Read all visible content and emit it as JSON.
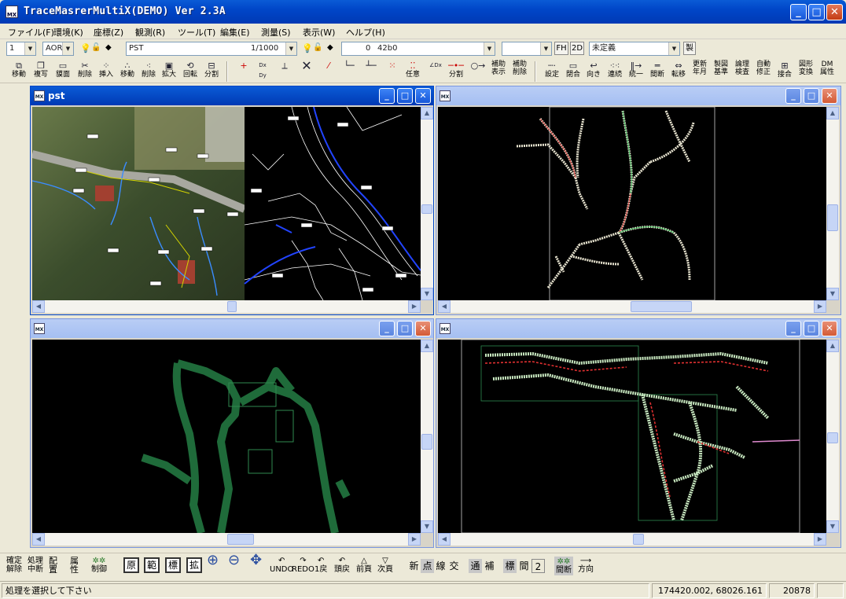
{
  "app": {
    "title": "TraceMasrerMultiX(DEMO) Ver 2.3A"
  },
  "menu": [
    "ファイル(F)",
    "環境(K)",
    "座標(Z)",
    "観測(R)",
    "ツール(T)",
    "編集(E)",
    "測量(S)",
    "表示(W)",
    "ヘルプ(H)"
  ],
  "row2": {
    "layer_num": "1",
    "mode": "AOR",
    "layer_name": "PST",
    "scale": "1/1000",
    "color_value": "0",
    "color_code": "42b0",
    "fh": "FH",
    "twod": "2D",
    "undefined_label": "未定義",
    "sei": "製"
  },
  "toolbar": {
    "group1": [
      "移動",
      "複写",
      "貘面",
      "削除",
      "挿入",
      "移動",
      "削除",
      "拡大",
      "回転",
      "分割"
    ],
    "group2": [
      "任意",
      "分割"
    ],
    "group2_aux": [
      [
        "補助",
        "表示"
      ],
      [
        "補助",
        "削除"
      ]
    ],
    "group3": [
      [
        "設定",
        ""
      ],
      [
        "閉合",
        ""
      ],
      [
        "向き",
        ""
      ],
      [
        "連続",
        ""
      ],
      [
        "統一",
        ""
      ],
      [
        "間断",
        ""
      ],
      [
        "転移",
        ""
      ],
      [
        "更新",
        "年月"
      ],
      [
        "製図",
        "基準"
      ],
      [
        "論理",
        "検査"
      ],
      [
        "自動",
        "修正"
      ],
      [
        "接合",
        ""
      ],
      [
        "図形",
        "変換"
      ],
      [
        "DM",
        "属性"
      ]
    ]
  },
  "windows": [
    {
      "title": "pst"
    },
    {
      "title": ""
    },
    {
      "title": ""
    },
    {
      "title": ""
    }
  ],
  "bottombar": {
    "g1": [
      [
        "確定",
        "解除"
      ],
      [
        "処理",
        "中断"
      ],
      [
        "配",
        "置"
      ],
      [
        "属",
        "性"
      ],
      [
        "",
        "制御"
      ]
    ],
    "boxes": [
      "原",
      "範",
      "標",
      "拡"
    ],
    "nav": [
      "UNDO",
      "REDO",
      "1戻",
      "頭戻",
      "前頁",
      "次頁"
    ],
    "seg1": [
      "新",
      "点",
      "線",
      "交"
    ],
    "seg2": [
      "通",
      "補"
    ],
    "seg3": [
      "標",
      "間",
      "2"
    ],
    "g_last": [
      "間断",
      "方向"
    ]
  },
  "status": {
    "message": "処理を選択して下さい",
    "coords": "174420.002,  68026.161",
    "count": "20878"
  }
}
